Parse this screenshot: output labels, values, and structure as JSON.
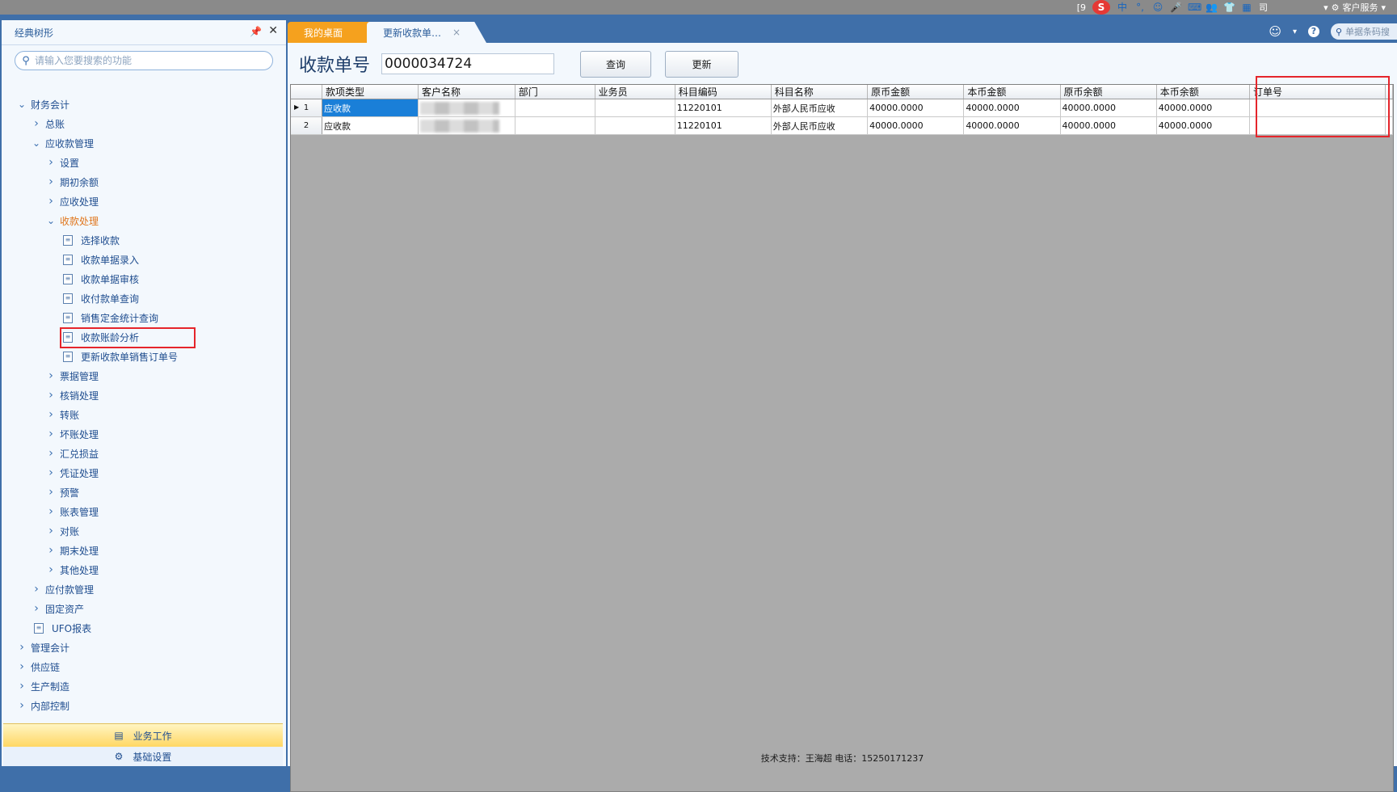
{
  "tray": {
    "left_text": "[9",
    "ime_chars": [
      "中",
      "°,"
    ],
    "right_text": "司",
    "customer_service": "客户服务"
  },
  "sidebar": {
    "title": "经典树形",
    "search_placeholder": "请输入您要搜索的功能",
    "tree": [
      {
        "label": "财务会计",
        "level": 0,
        "expanded": true
      },
      {
        "label": "总账",
        "level": 1,
        "expanded": false
      },
      {
        "label": "应收款管理",
        "level": 1,
        "expanded": true
      },
      {
        "label": "设置",
        "level": 2,
        "expanded": false
      },
      {
        "label": "期初余额",
        "level": 2,
        "expanded": false
      },
      {
        "label": "应收处理",
        "level": 2,
        "expanded": false
      },
      {
        "label": "收款处理",
        "level": 2,
        "expanded": true,
        "active": true
      },
      {
        "label": "选择收款",
        "level": 3,
        "leaf": true
      },
      {
        "label": "收款单据录入",
        "level": 3,
        "leaf": true
      },
      {
        "label": "收款单据审核",
        "level": 3,
        "leaf": true
      },
      {
        "label": "收付款单查询",
        "level": 3,
        "leaf": true
      },
      {
        "label": "销售定金统计查询",
        "level": 3,
        "leaf": true
      },
      {
        "label": "收款账龄分析",
        "level": 3,
        "leaf": true
      },
      {
        "label": "更新收款单销售订单号",
        "level": 3,
        "leaf": true,
        "highlighted": true
      },
      {
        "label": "票据管理",
        "level": 2,
        "expanded": false
      },
      {
        "label": "核销处理",
        "level": 2,
        "expanded": false
      },
      {
        "label": "转账",
        "level": 2,
        "expanded": false
      },
      {
        "label": "坏账处理",
        "level": 2,
        "expanded": false
      },
      {
        "label": "汇兑损益",
        "level": 2,
        "expanded": false
      },
      {
        "label": "凭证处理",
        "level": 2,
        "expanded": false
      },
      {
        "label": "预警",
        "level": 2,
        "expanded": false
      },
      {
        "label": "账表管理",
        "level": 2,
        "expanded": false
      },
      {
        "label": "对账",
        "level": 2,
        "expanded": false
      },
      {
        "label": "期末处理",
        "level": 2,
        "expanded": false
      },
      {
        "label": "其他处理",
        "level": 2,
        "expanded": false
      },
      {
        "label": "应付款管理",
        "level": 1,
        "expanded": false
      },
      {
        "label": "固定资产",
        "level": 1,
        "expanded": false
      },
      {
        "label": "UFO报表",
        "level": 1,
        "leaf": true
      },
      {
        "label": "管理会计",
        "level": 0,
        "expanded": false
      },
      {
        "label": "供应链",
        "level": 0,
        "expanded": false
      },
      {
        "label": "生产制造",
        "level": 0,
        "expanded": false
      },
      {
        "label": "内部控制",
        "level": 0,
        "expanded": false
      }
    ],
    "bottom_work": "业务工作",
    "bottom_base": "基础设置"
  },
  "tabs": {
    "home": "我的桌面",
    "current": "更新收款单…",
    "quick_search_placeholder": "单据条码搜"
  },
  "query": {
    "label": "收款单号",
    "value": "0000034724",
    "query_button": "查询",
    "update_button": "更新"
  },
  "grid": {
    "columns": [
      "款项类型",
      "客户名称",
      "部门",
      "业务员",
      "科目编码",
      "科目名称",
      "原币金额",
      "本币金额",
      "原币余额",
      "本币余额",
      "订单号"
    ],
    "rows": [
      {
        "no": "1",
        "cells": [
          "应收款",
          "",
          "",
          "",
          "11220101",
          "外部人民币应收",
          "40000.0000",
          "40000.0000",
          "40000.0000",
          "40000.0000",
          ""
        ]
      },
      {
        "no": "2",
        "cells": [
          "应收款",
          "",
          "",
          "",
          "11220101",
          "外部人民币应收",
          "40000.0000",
          "40000.0000",
          "40000.0000",
          "40000.0000",
          ""
        ]
      }
    ]
  },
  "footer": "技术支持：王海超   电话：15250171237",
  "colors": {
    "frame_blue": "#3f6fa9",
    "tab_orange": "#f5a11e",
    "selection_blue": "#1a7fd8",
    "highlight_red": "#e5252b"
  }
}
